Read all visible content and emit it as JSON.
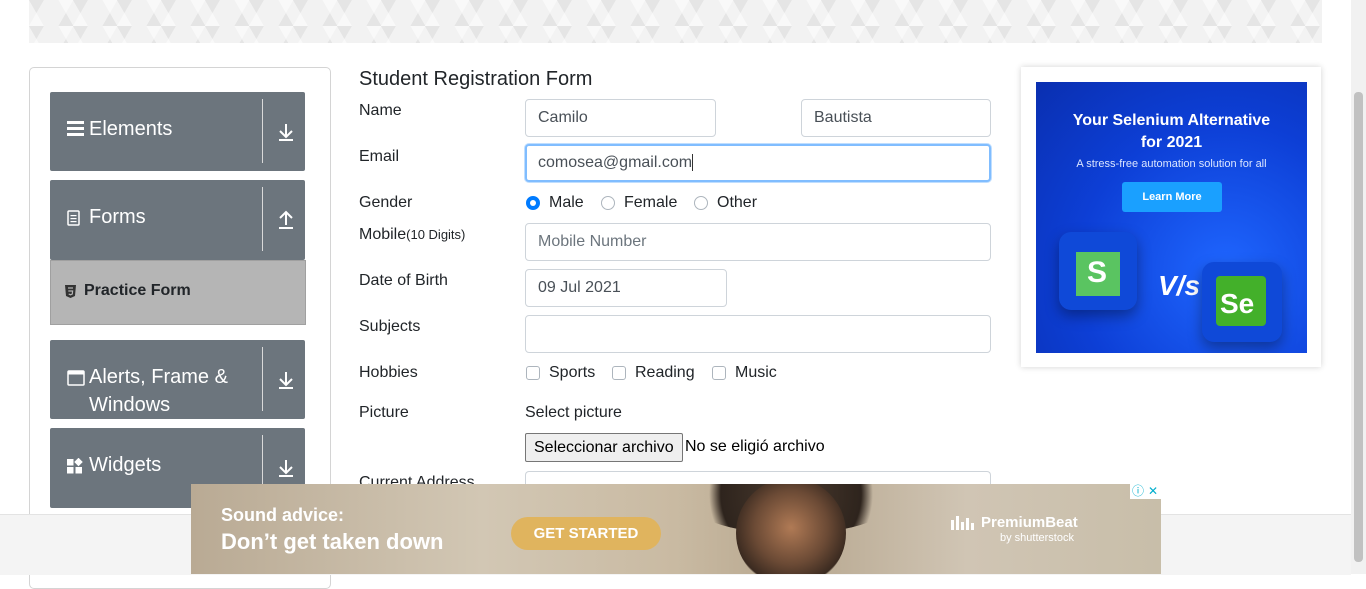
{
  "menu": {
    "groups": [
      {
        "label": "Elements",
        "icon": "list-icon",
        "arrow": "arrow-down-icon"
      },
      {
        "label": "Forms",
        "icon": "document-icon",
        "arrow": "arrow-up-icon"
      },
      {
        "label_line1": "Alerts, Frame &",
        "label_line2": "Windows",
        "icon": "window-icon",
        "arrow": "arrow-down-icon"
      },
      {
        "label": "Widgets",
        "icon": "widgets-icon",
        "arrow": "arrow-down-icon"
      }
    ],
    "active_item": {
      "label": "Practice Form",
      "icon": "html5-icon"
    }
  },
  "form": {
    "title": "Student Registration Form",
    "name_label": "Name",
    "first_name": "Camilo",
    "last_name": "Bautista",
    "email_label": "Email",
    "email_value": "comosea@gmail.com",
    "gender_label": "Gender",
    "gender_options": [
      "Male",
      "Female",
      "Other"
    ],
    "gender_selected": "Male",
    "mobile_label": "Mobile",
    "mobile_hint": "(10 Digits)",
    "mobile_placeholder": "Mobile Number",
    "dob_label": "Date of Birth",
    "dob_value": "09 Jul 2021",
    "subjects_label": "Subjects",
    "subjects_value": "",
    "hobbies_label": "Hobbies",
    "hobbies": [
      "Sports",
      "Reading",
      "Music"
    ],
    "picture_label": "Picture",
    "picture_prompt": "Select picture",
    "file_button": "Seleccionar archivo",
    "file_status": "No se eligió archivo",
    "address_label": "Current Address"
  },
  "side_ad": {
    "title_line1": "Your Selenium Alternative",
    "title_line2": "for 2021",
    "subtitle": "A stress-free automation solution for all",
    "button": "Learn More",
    "vs_text": "V/s",
    "logo_left": "S",
    "logo_right": "Se"
  },
  "bottom_ad": {
    "line1": "Sound advice:",
    "line2": "Don’t get taken down",
    "cta": "GET STARTED",
    "brand": "PremiumBeat",
    "brand_sub": "by shutterstock",
    "info_symbol": "ⓘ",
    "close_symbol": "✕"
  },
  "colors": {
    "menu_bg": "#6c757d",
    "active_bg": "#b5b5b5",
    "focus_border": "#80bdff",
    "radio_checked": "#007bff",
    "ad_blue": "#0d3fd6",
    "cta_gold": "#e0b45e"
  }
}
